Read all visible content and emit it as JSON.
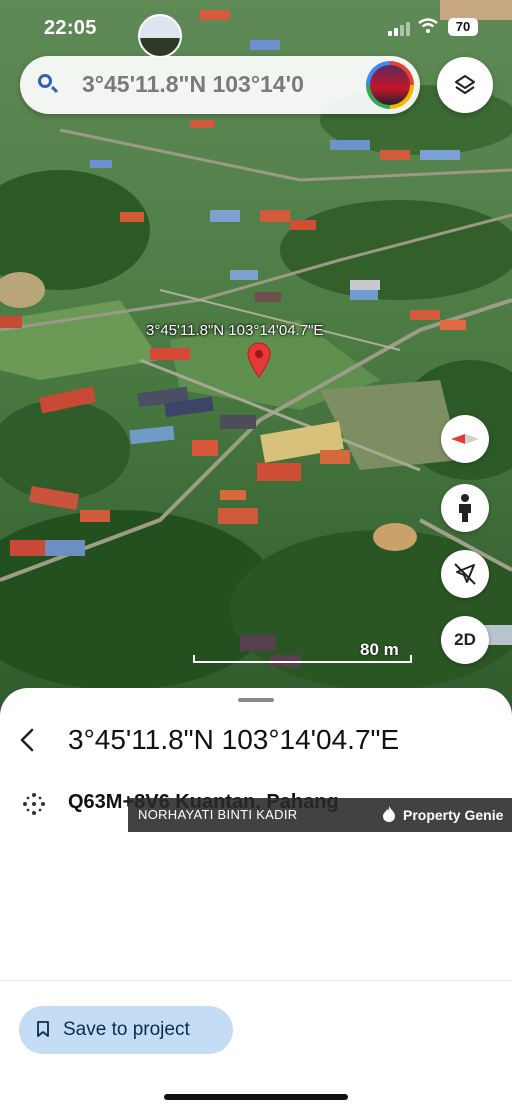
{
  "status_bar": {
    "time": "22:05",
    "battery": "70"
  },
  "search": {
    "query": "3°45'11.8\"N 103°14'0"
  },
  "pin": {
    "label": "3°45'11.8\"N 103°14'04.7\"E"
  },
  "controls": {
    "view_mode": "2D"
  },
  "scale": {
    "label": "80 m"
  },
  "place": {
    "title": "3°45'11.8\"N 103°14'04.7\"E",
    "plus_code": "Q63M+8V6 Kuantan, Pahang"
  },
  "watermark": {
    "name": "NORHAYATI BINTI KADIR",
    "brand": "Property Genie"
  },
  "actions": {
    "save_label": "Save to project"
  },
  "colors": {
    "accent": "#c5dcf5",
    "pin": "#e53935",
    "search_icon": "#2f62b6"
  }
}
